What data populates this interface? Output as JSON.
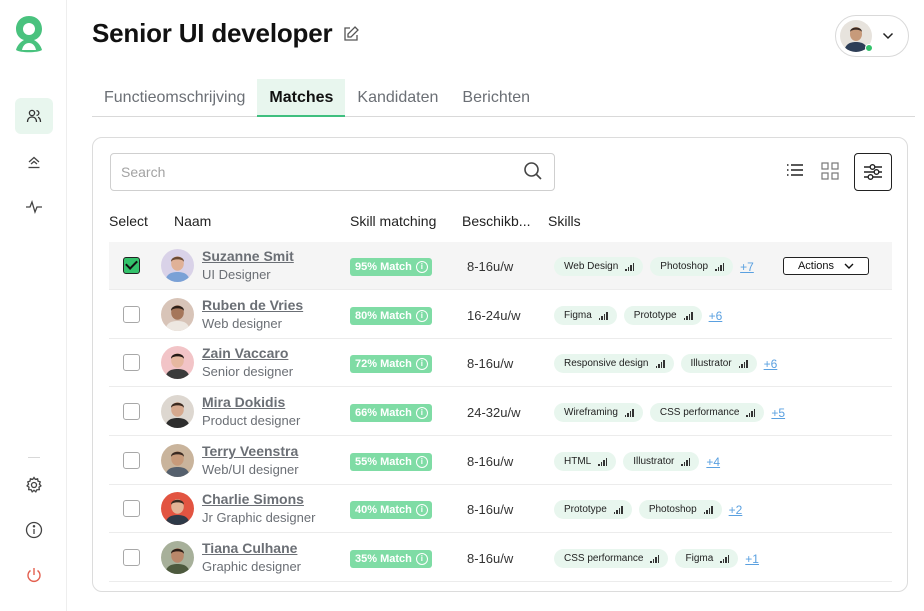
{
  "header": {
    "title": "Senior UI developer"
  },
  "tabs": [
    {
      "label": "Functieomschrijving",
      "active": false
    },
    {
      "label": "Matches",
      "active": true
    },
    {
      "label": "Kandidaten",
      "active": false
    },
    {
      "label": "Berichten",
      "active": false
    }
  ],
  "search": {
    "placeholder": "Search"
  },
  "columns": {
    "select": "Select",
    "name": "Naam",
    "skill": "Skill matching",
    "avail": "Beschikb...",
    "skills": "Skills"
  },
  "actions_label": "Actions",
  "colors": {
    "accent": "#33c26b",
    "match_badge": "#7fdca5",
    "chip_bg": "#e8f6ee",
    "link": "#5aa0e0",
    "logout": "#e36050"
  },
  "rows": [
    {
      "name": "Suzanne Smit",
      "role": "UI Designer",
      "match": "95% Match",
      "avail": "8-16u/w",
      "selected": true,
      "skills": [
        {
          "label": "Web Design"
        },
        {
          "label": "Photoshop"
        }
      ],
      "more": "+7"
    },
    {
      "name": "Ruben de Vries",
      "role": "Web designer",
      "match": "80% Match",
      "avail": "16-24u/w",
      "selected": false,
      "skills": [
        {
          "label": "Figma"
        },
        {
          "label": "Prototype"
        }
      ],
      "more": "+6"
    },
    {
      "name": "Zain Vaccaro",
      "role": "Senior designer",
      "match": "72% Match",
      "avail": "8-16u/w",
      "selected": false,
      "skills": [
        {
          "label": "Responsive design"
        },
        {
          "label": "Illustrator"
        }
      ],
      "more": "+6"
    },
    {
      "name": "Mira Dokidis",
      "role": "Product designer",
      "match": "66% Match",
      "avail": "24-32u/w",
      "selected": false,
      "skills": [
        {
          "label": "Wireframing"
        },
        {
          "label": "CSS performance"
        }
      ],
      "more": "+5"
    },
    {
      "name": "Terry Veenstra",
      "role": "Web/UI designer",
      "match": "55% Match",
      "avail": "8-16u/w",
      "selected": false,
      "skills": [
        {
          "label": "HTML"
        },
        {
          "label": "Illustrator"
        }
      ],
      "more": "+4"
    },
    {
      "name": "Charlie Simons",
      "role": "Jr Graphic designer",
      "match": "40% Match",
      "avail": "8-16u/w",
      "selected": false,
      "skills": [
        {
          "label": "Prototype"
        },
        {
          "label": "Photoshop"
        }
      ],
      "more": "+2"
    },
    {
      "name": "Tiana Culhane",
      "role": "Graphic designer",
      "match": "35% Match",
      "avail": "8-16u/w",
      "selected": false,
      "skills": [
        {
          "label": "CSS performance"
        },
        {
          "label": "Figma"
        }
      ],
      "more": "+1"
    }
  ]
}
